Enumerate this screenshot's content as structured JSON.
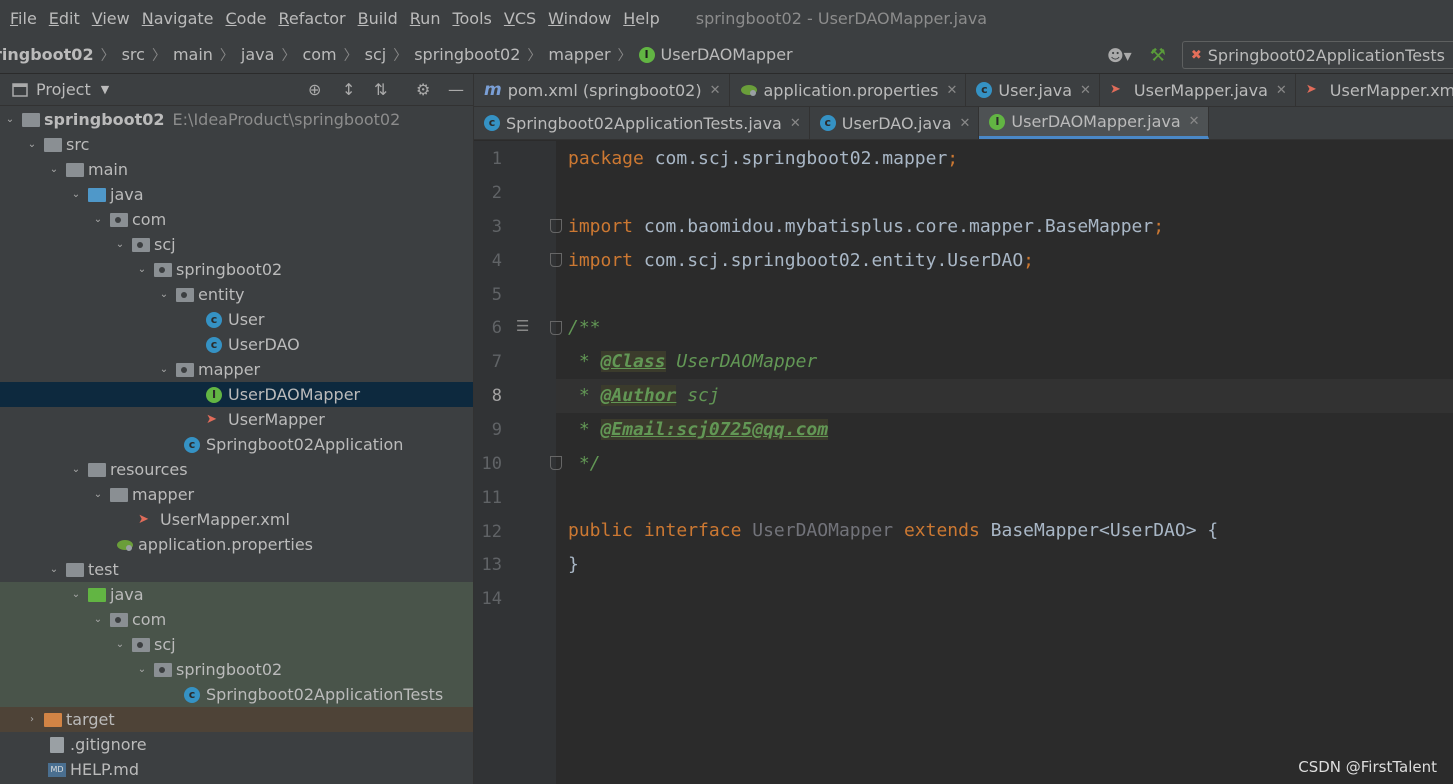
{
  "menu": {
    "items": [
      {
        "mnemonic": "F",
        "rest": "ile"
      },
      {
        "mnemonic": "E",
        "rest": "dit"
      },
      {
        "mnemonic": "V",
        "rest": "iew"
      },
      {
        "mnemonic": "N",
        "rest": "avigate"
      },
      {
        "mnemonic": "C",
        "rest": "ode"
      },
      {
        "mnemonic": "R",
        "rest": "efactor"
      },
      {
        "mnemonic": "B",
        "rest": "uild"
      },
      {
        "mnemonic": "R",
        "rest": "un"
      },
      {
        "mnemonic": "T",
        "rest": "ools"
      },
      {
        "mnemonic": "V",
        "rest": "CS"
      },
      {
        "mnemonic": "W",
        "rest": "indow"
      },
      {
        "mnemonic": "H",
        "rest": "elp"
      }
    ],
    "window_title": "springboot02 - UserDAOMapper.java"
  },
  "navbar": {
    "crumbs": [
      "ringboot02",
      "src",
      "main",
      "java",
      "com",
      "scj",
      "springboot02",
      "mapper",
      "UserDAOMapper"
    ],
    "run_config": "Springboot02ApplicationTests"
  },
  "project": {
    "title": "Project",
    "root_name": "springboot02",
    "root_path": "E:\\IdeaProduct\\springboot02",
    "tree": {
      "src": "src",
      "main": "main",
      "java": "java",
      "com": "com",
      "scj": "scj",
      "springboot02": "springboot02",
      "entity": "entity",
      "user": "User",
      "userdao": "UserDAO",
      "mapper": "mapper",
      "userdaomapper": "UserDAOMapper",
      "usermapper": "UserMapper",
      "application": "Springboot02Application",
      "resources": "resources",
      "res_mapper": "mapper",
      "usermapper_xml": "UserMapper.xml",
      "app_props": "application.properties",
      "test": "test",
      "test_java": "java",
      "test_com": "com",
      "test_scj": "scj",
      "test_springboot02": "springboot02",
      "tests_class": "Springboot02ApplicationTests",
      "target": "target",
      "gitignore": ".gitignore",
      "help": "HELP.md"
    }
  },
  "tabs": {
    "row1": [
      "pom.xml (springboot02)",
      "application.properties",
      "User.java",
      "UserMapper.java",
      "UserMapper.xml"
    ],
    "row2": [
      "Springboot02ApplicationTests.java",
      "UserDAO.java",
      "UserDAOMapper.java"
    ]
  },
  "editor": {
    "line_numbers": [
      "1",
      "2",
      "3",
      "4",
      "5",
      "6",
      "7",
      "8",
      "9",
      "10",
      "11",
      "12",
      "13",
      "14"
    ],
    "current_line": 8,
    "code": {
      "l1_kw": "package",
      "l1_rest": " com.scj.springboot02.mapper",
      "l1_semi": ";",
      "l3_kw": "import",
      "l3_rest": " com.baomidou.mybatisplus.core.mapper.BaseMapper",
      "l3_semi": ";",
      "l4_kw": "import",
      "l4_rest": " com.scj.springboot02.entity.UserDAO",
      "l4_semi": ";",
      "l6": "/**",
      "l7_star": " * ",
      "l7_tag": "@Class",
      "l7_text": " UserDAOMapper",
      "l8_star": " * ",
      "l8_tag": "@Author",
      "l8_text": " scj",
      "l9_star": " * ",
      "l9_tag": "@Email:scj0725@qq.com",
      "l10": " */",
      "l12_kw1": "public",
      "l12_kw2": " interface",
      "l12_name": " UserDAOMapper",
      "l12_kw3": " extends",
      "l12_rest": " BaseMapper<UserDAO> {",
      "l13": "}"
    }
  },
  "watermark": "CSDN @FirstTalent",
  "colors": {
    "keyword": "#cc7832",
    "doc": "#629755",
    "selection": "#0d293e",
    "accent": "#4a88c7"
  }
}
